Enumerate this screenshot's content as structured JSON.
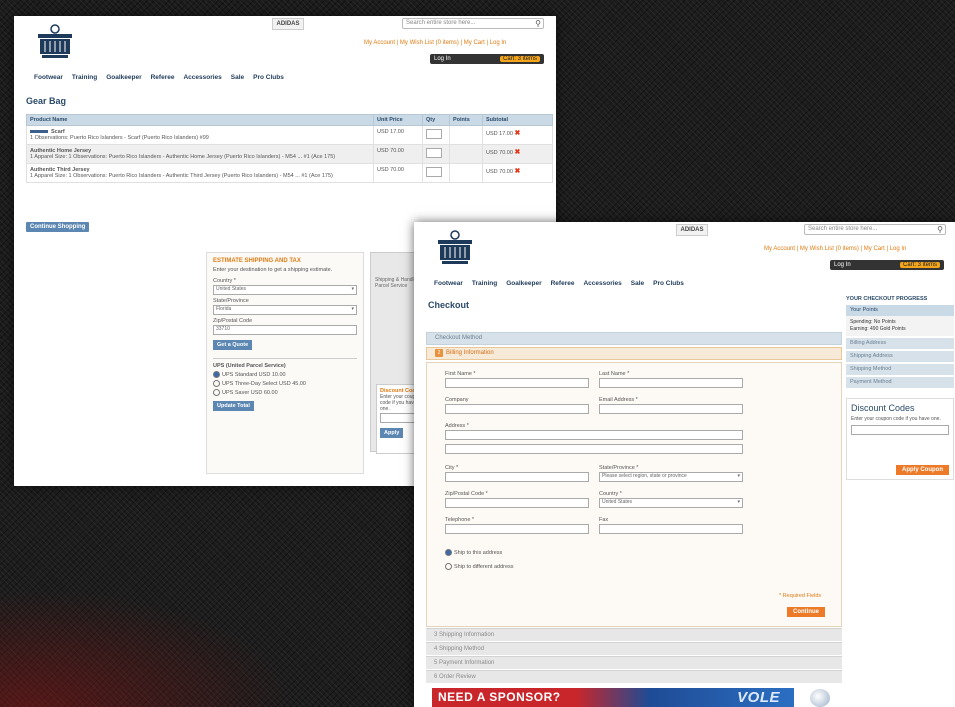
{
  "cart": {
    "search_placeholder": "Search entire store here...",
    "brand_tab": "ADIDAS",
    "top_links": "My Account | My Wish List (0 items) | My Cart | Log In",
    "login_label": "Log In",
    "cart_label": "Cart: 3 items",
    "nav": [
      "Footwear",
      "Training",
      "Goalkeeper",
      "Referee",
      "Accessories",
      "Sale",
      "Pro Clubs"
    ],
    "title": "Gear Bag",
    "columns": [
      "Product Name",
      "Unit Price",
      "Qty",
      "Points",
      "Subtotal"
    ],
    "rows": [
      {
        "name": "Scarf",
        "detail": "1 Observations: Puerto Rico Islanders - Scarf (Puerto Rico Islanders) #99",
        "price": "USD 17.00",
        "subtotal": "USD 17.00"
      },
      {
        "name": "Authentic Home Jersey",
        "detail": "1 Apparel Size: 1 Observations: Puerto Rico Islanders - Authentic Home Jersey (Puerto Rico Islanders) - M54 ... #1 (Ace 175)",
        "price": "USD 70.00",
        "subtotal": "USD 70.00"
      },
      {
        "name": "Authentic Third Jersey",
        "detail": "1 Apparel Size: 1 Observations: Puerto Rico Islanders - Authentic Third Jersey (Puerto Rico Islanders) - M54 ... #1 (Ace 175)",
        "price": "USD 70.00",
        "subtotal": "USD 70.00"
      }
    ],
    "continue_label": "Continue Shopping",
    "estimate": {
      "heading": "ESTIMATE SHIPPING AND TAX",
      "desc": "Enter your destination to get a shipping estimate.",
      "country_label": "Country *",
      "country_value": "United States",
      "state_label": "State/Province",
      "state_value": "Florida",
      "zip_label": "Zip/Postal Code",
      "zip_value": "33710",
      "get_quote": "Get a Quote",
      "ups_heading": "UPS (United Parcel Service)",
      "ups_options": [
        "UPS Standard USD 10.00",
        "UPS Three-Day Select USD 45.00",
        "UPS Saver USD 60.00"
      ],
      "update_total": "Update Total"
    },
    "side_box_text": "Shipping & Handling Parcel Service",
    "discount_heading": "Discount Codes",
    "discount_desc": "Enter your coupon code if you have one.",
    "apply_short": "Apply"
  },
  "checkout": {
    "search_placeholder": "Search entire store here...",
    "brand_tab": "ADIDAS",
    "top_links": "My Account | My Wish List (0 items) | My Cart | Log In",
    "login_label": "Log In",
    "cart_label": "Cart: 3 items",
    "nav": [
      "Footwear",
      "Training",
      "Goalkeeper",
      "Referee",
      "Accessories",
      "Sale",
      "Pro Clubs"
    ],
    "title": "Checkout",
    "checkout_method": "Checkout Method",
    "billing_step": "2",
    "billing_title": "Billing Information",
    "fields": {
      "first_name": "First Name *",
      "last_name": "Last Name *",
      "company": "Company",
      "email": "Email Address *",
      "address": "Address *",
      "city": "City *",
      "state": "State/Province *",
      "state_placeholder": "Please select region, state or province",
      "zip": "Zip/Postal Code *",
      "country": "Country *",
      "country_value": "United States",
      "telephone": "Telephone *",
      "fax": "Fax"
    },
    "ship_same": "Ship to this address",
    "ship_diff": "Ship to different address",
    "required": "* Required Fields",
    "continue": "Continue",
    "collapsed_steps": [
      "3   Shipping Information",
      "4   Shipping Method",
      "5   Payment Information",
      "6   Order Review"
    ],
    "sidebar": {
      "title": "YOUR CHECKOUT PROGRESS",
      "items": [
        "Your Points",
        "Billing Address",
        "Shipping Address",
        "Shipping Method",
        "Payment Method"
      ],
      "points_detail_1": "Spending: No Points",
      "points_detail_2": "Earning: 490 Gold Points",
      "discount_heading": "Discount Codes",
      "discount_desc": "Enter your coupon code if you have one.",
      "apply": "Apply Coupon"
    },
    "banner_text": "NEED A SPONSOR?",
    "banner_right": "VOLE"
  }
}
